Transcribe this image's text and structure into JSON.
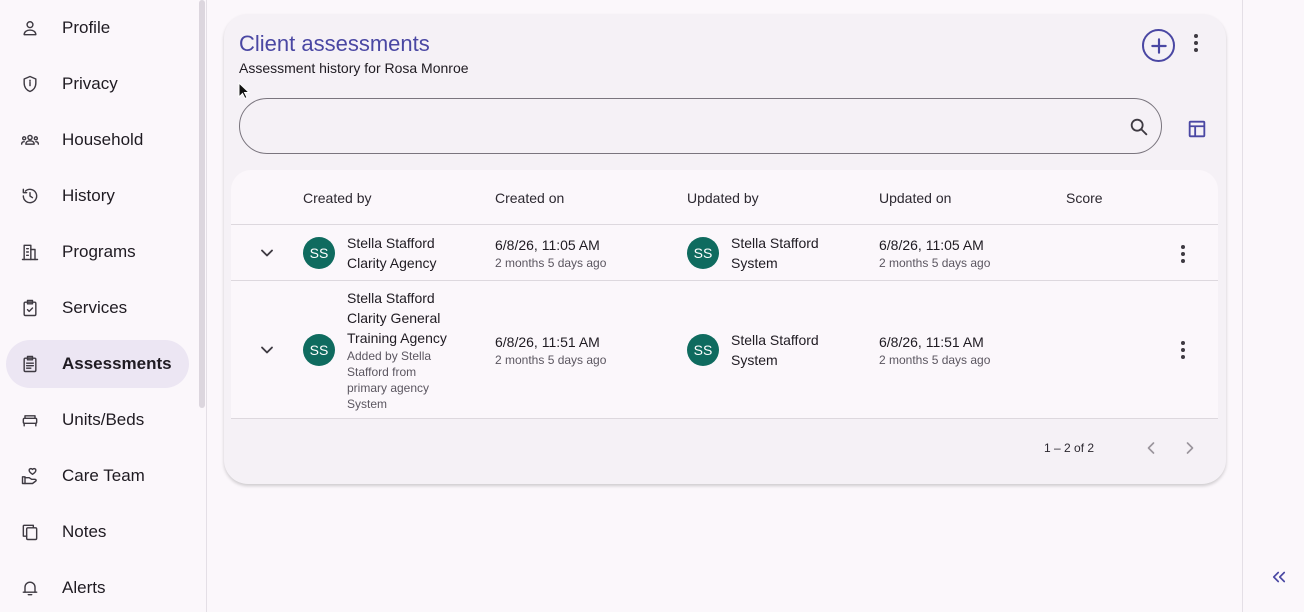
{
  "sidebar": {
    "items": [
      {
        "label": "Profile",
        "icon": "person-icon"
      },
      {
        "label": "Privacy",
        "icon": "shield-icon"
      },
      {
        "label": "Household",
        "icon": "group-icon"
      },
      {
        "label": "History",
        "icon": "history-icon"
      },
      {
        "label": "Programs",
        "icon": "programs-icon"
      },
      {
        "label": "Services",
        "icon": "clipboard-check-icon"
      },
      {
        "label": "Assessments",
        "icon": "assignment-icon",
        "active": true
      },
      {
        "label": "Units/Beds",
        "icon": "bed-icon"
      },
      {
        "label": "Care Team",
        "icon": "hand-heart-icon"
      },
      {
        "label": "Notes",
        "icon": "notes-icon"
      },
      {
        "label": "Alerts",
        "icon": "bell-icon"
      }
    ]
  },
  "card": {
    "title": "Client assessments",
    "subtitle": "Assessment history for Rosa Monroe",
    "search_value": ""
  },
  "table": {
    "columns": [
      "Created by",
      "Created on",
      "Updated by",
      "Updated on",
      "Score"
    ],
    "rows": [
      {
        "created_by_initials": "SS",
        "created_by_name": "Stella Stafford",
        "created_by_agency": "Clarity Agency",
        "created_by_note": "",
        "created_on": "6/8/26, 11:05 AM",
        "created_on_rel": "2 months 5 days ago",
        "updated_by_initials": "SS",
        "updated_by_name": "Stella Stafford",
        "updated_by_agency": "System",
        "updated_on": "6/8/26, 11:05 AM",
        "updated_on_rel": "2 months 5 days ago",
        "score": ""
      },
      {
        "created_by_initials": "SS",
        "created_by_name": "Stella Stafford",
        "created_by_agency": "Clarity General Training Agency",
        "created_by_note": "Added by Stella Stafford from primary agency System",
        "created_on": "6/8/26, 11:51 AM",
        "created_on_rel": "2 months 5 days ago",
        "updated_by_initials": "SS",
        "updated_by_name": "Stella Stafford",
        "updated_by_agency": "System",
        "updated_on": "6/8/26, 11:51 AM",
        "updated_on_rel": "2 months 5 days ago",
        "score": ""
      }
    ]
  },
  "pager": {
    "range": "1 – 2 of 2"
  },
  "colors": {
    "accent": "#4a47a3",
    "avatar": "#0f6b5f",
    "active_nav_bg": "#ece6f3"
  }
}
